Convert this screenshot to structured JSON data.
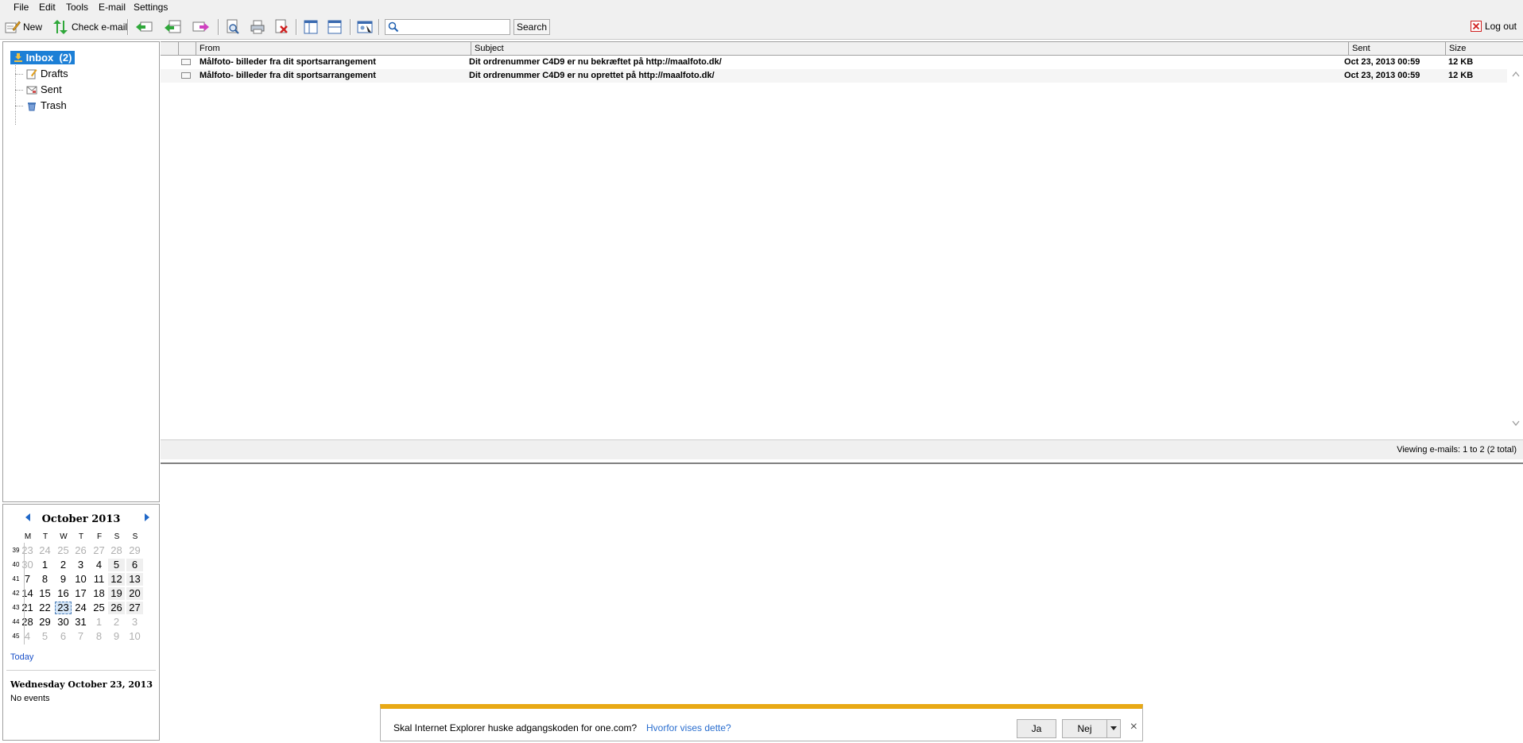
{
  "menu": [
    "File",
    "Edit",
    "Tools",
    "E-mail",
    "Settings"
  ],
  "toolbar": {
    "new_label": "New",
    "check_label": "Check e-mail",
    "search_label": "Search",
    "search_placeholder": "",
    "logout_label": "Log out"
  },
  "folders": {
    "inbox": "Inbox",
    "inbox_count": "(2)",
    "drafts": "Drafts",
    "sent": "Sent",
    "trash": "Trash"
  },
  "calendar": {
    "month_title": "October 2013",
    "dow": [
      "M",
      "T",
      "W",
      "T",
      "F",
      "S",
      "S"
    ],
    "weeks": [
      {
        "wk": "39",
        "days": [
          {
            "d": "23",
            "dim": true
          },
          {
            "d": "24",
            "dim": true
          },
          {
            "d": "25",
            "dim": true
          },
          {
            "d": "26",
            "dim": true
          },
          {
            "d": "27",
            "dim": true
          },
          {
            "d": "28",
            "dim": true
          },
          {
            "d": "29",
            "dim": true
          }
        ]
      },
      {
        "wk": "40",
        "days": [
          {
            "d": "30",
            "dim": true
          },
          {
            "d": "1"
          },
          {
            "d": "2"
          },
          {
            "d": "3"
          },
          {
            "d": "4"
          },
          {
            "d": "5"
          },
          {
            "d": "6"
          }
        ]
      },
      {
        "wk": "41",
        "days": [
          {
            "d": "7"
          },
          {
            "d": "8"
          },
          {
            "d": "9"
          },
          {
            "d": "10"
          },
          {
            "d": "11"
          },
          {
            "d": "12"
          },
          {
            "d": "13"
          }
        ]
      },
      {
        "wk": "42",
        "days": [
          {
            "d": "14"
          },
          {
            "d": "15"
          },
          {
            "d": "16"
          },
          {
            "d": "17"
          },
          {
            "d": "18"
          },
          {
            "d": "19"
          },
          {
            "d": "20"
          }
        ]
      },
      {
        "wk": "43",
        "days": [
          {
            "d": "21"
          },
          {
            "d": "22"
          },
          {
            "d": "23",
            "today": true
          },
          {
            "d": "24"
          },
          {
            "d": "25"
          },
          {
            "d": "26"
          },
          {
            "d": "27"
          }
        ]
      },
      {
        "wk": "44",
        "days": [
          {
            "d": "28"
          },
          {
            "d": "29"
          },
          {
            "d": "30"
          },
          {
            "d": "31"
          },
          {
            "d": "1",
            "dim": true
          },
          {
            "d": "2",
            "dim": true
          },
          {
            "d": "3",
            "dim": true
          }
        ]
      },
      {
        "wk": "45",
        "days": [
          {
            "d": "4",
            "dim": true
          },
          {
            "d": "5",
            "dim": true
          },
          {
            "d": "6",
            "dim": true
          },
          {
            "d": "7",
            "dim": true
          },
          {
            "d": "8",
            "dim": true
          },
          {
            "d": "9",
            "dim": true
          },
          {
            "d": "10",
            "dim": true
          }
        ]
      }
    ],
    "today_label": "Today",
    "selected_date": "Wednesday October 23, 2013",
    "no_events": "No events"
  },
  "list": {
    "columns": {
      "from": "From",
      "subject": "Subject",
      "sent": "Sent",
      "size": "Size"
    },
    "emails": [
      {
        "from": "Målfoto- billeder fra dit sportsarrangement",
        "subject": "Dit ordrenummer C4D9 er nu bekræftet på http://maalfoto.dk/",
        "sent": "Oct 23, 2013 00:59",
        "size": "12 KB"
      },
      {
        "from": "Målfoto- billeder fra dit sportsarrangement",
        "subject": "Dit ordrenummer C4D9 er nu oprettet på http://maalfoto.dk/",
        "sent": "Oct 23, 2013 00:59",
        "size": "12 KB"
      }
    ],
    "status": "Viewing e-mails: 1 to 2 (2 total)"
  },
  "notification": {
    "text": "Skal Internet Explorer huske adgangskoden for one.com?",
    "link": "Hvorfor vises dette?",
    "yes": "Ja",
    "no": "Nej"
  },
  "colors": {
    "accent": "#1c7fd6",
    "notify_bar": "#e8a915",
    "link": "#2a6ecf"
  }
}
